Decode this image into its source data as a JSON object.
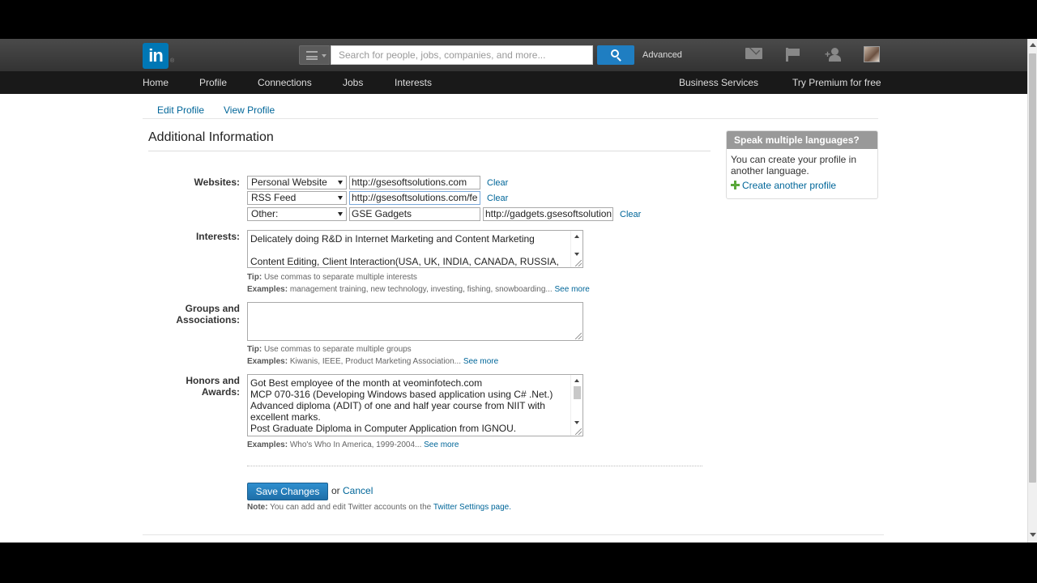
{
  "topbar": {
    "logo_text": "in",
    "logo_mark": "®",
    "search_placeholder": "Search for people, jobs, companies, and more...",
    "advanced_label": "Advanced",
    "icons": [
      "menu-icon",
      "search-icon",
      "mail-icon",
      "flag-icon",
      "add-connection-icon",
      "avatar"
    ]
  },
  "nav": {
    "left": [
      "Home",
      "Profile",
      "Connections",
      "Jobs",
      "Interests"
    ],
    "right": [
      "Business Services",
      "Try Premium for free"
    ]
  },
  "subtabs": [
    "Edit Profile",
    "View Profile"
  ],
  "section_title": "Additional Information",
  "websites": {
    "label": "Websites:",
    "rows": [
      {
        "type": "Personal Website",
        "url": "http://gsesoftsolutions.com",
        "name": "",
        "clear": "Clear"
      },
      {
        "type": "RSS Feed",
        "url": "http://gsesoftsolutions.com/fe",
        "name": "",
        "clear": "Clear"
      },
      {
        "type": "Other:",
        "name": "GSE Gadgets",
        "url": "http://gadgets.gsesoftsolution",
        "clear": "Clear"
      }
    ]
  },
  "interests": {
    "label": "Interests:",
    "lines": [
      "Delicately doing R&D in Internet Marketing and Content Marketing",
      "",
      "Content Editing, Client Interaction(USA, UK, INDIA, CANADA, RUSSIA,"
    ],
    "tip_label": "Tip:",
    "tip": "Use commas to separate multiple interests",
    "examples_label": "Examples:",
    "examples": "management training, new technology, investing, fishing, snowboarding...",
    "see_more": "See more"
  },
  "groups": {
    "label_line1": "Groups and",
    "label_line2": "Associations:",
    "tip_label": "Tip:",
    "tip": "Use commas to separate multiple groups",
    "examples_label": "Examples:",
    "examples": "Kiwanis, IEEE, Product Marketing Association...",
    "see_more": "See more"
  },
  "honors": {
    "label_line1": "Honors and",
    "label_line2": "Awards:",
    "lines": [
      "Got Best employee of the month at veominfotech.com",
      "MCP 070-316 (Developing Windows based application using C# .Net.)",
      "Advanced diploma (ADIT) of one and half year course from NIIT with",
      "excellent marks.",
      "Post Graduate Diploma in Computer Application from IGNOU."
    ],
    "examples_label": "Examples:",
    "examples": "Who's Who In America, 1999-2004...",
    "see_more": "See more"
  },
  "actions": {
    "save": "Save Changes",
    "or": "or",
    "cancel": "Cancel",
    "note_label": "Note:",
    "note": "You can add and edit Twitter accounts on the",
    "note_link": "Twitter Settings page."
  },
  "sidebox": {
    "title": "Speak multiple languages?",
    "text": "You can create your profile in another language.",
    "link": "Create another profile"
  },
  "colors": {
    "link": "#006699",
    "primary_button": "#1f7ec2",
    "nav_bg": "#191919",
    "topbar_bg": "#3d3d3d",
    "brand": "#0077b5"
  }
}
